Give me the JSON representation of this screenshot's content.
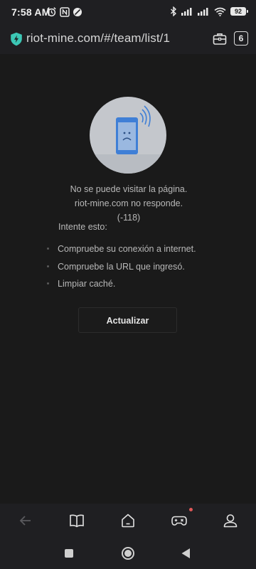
{
  "status_bar": {
    "time": "7:58 AM",
    "battery": "92",
    "left_icons": [
      "alarm-icon",
      "nfc-icon",
      "data-saver-icon"
    ],
    "right_icons": [
      "bluetooth-icon",
      "signal-icon",
      "signal-icon",
      "wifi-icon",
      "battery-icon"
    ]
  },
  "url_bar": {
    "url": "riot-mine.com/#/team/list/1",
    "security_icon": "shield-icon",
    "toolbox_icon": "toolbox-icon",
    "tabs_count": "6"
  },
  "error_page": {
    "illustration_icon": "disconnected-phone-icon",
    "message": "No se puede visitar la página. riot-mine.com no responde. (-118)",
    "tips_heading": "Intente esto:",
    "tips": [
      "Compruebe su conexión a internet.",
      "Compruebe la URL que ingresó.",
      "Limpiar caché."
    ],
    "reload_label": "Actualizar"
  },
  "bottom_bar": {
    "items": [
      "back-arrow-icon",
      "bookmarks-icon",
      "home-icon",
      "games-icon",
      "profile-icon"
    ],
    "games_has_notification": true
  },
  "android_nav": {
    "items": [
      "recents-square-icon",
      "home-circle-icon",
      "back-triangle-icon"
    ]
  },
  "colors": {
    "background": "#1a1a1a",
    "bar_background": "#1f1f22",
    "shield_accent": "#3cc7b5",
    "notification": "#e05858",
    "phone_blue": "#3f7fd6"
  }
}
